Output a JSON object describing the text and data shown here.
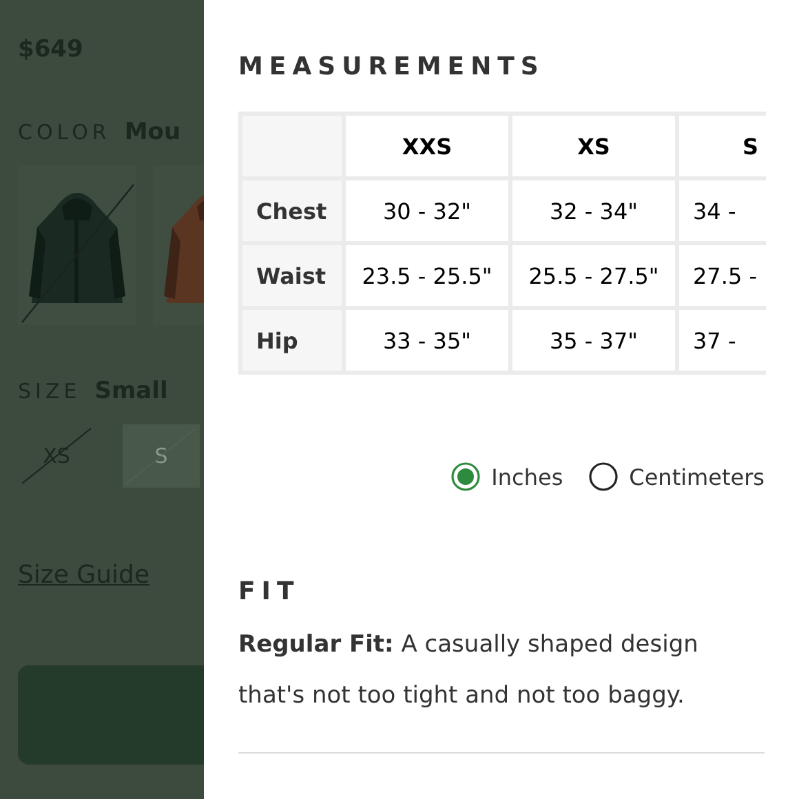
{
  "product": {
    "price": "$649",
    "color_label": "COLOR",
    "color_value": "Mou",
    "swatches": [
      {
        "kind": "picture",
        "available": false
      },
      {
        "kind": "picture",
        "available": true
      }
    ],
    "size_label": "SIZE",
    "size_value": "Small",
    "sizes": [
      {
        "label": "XS",
        "available": false,
        "selected": false
      },
      {
        "label": "S",
        "available": false,
        "selected": true
      }
    ],
    "size_guide_link": "Size Guide"
  },
  "measurements": {
    "title": "MEASUREMENTS",
    "columns": [
      "XXS",
      "XS",
      "S"
    ],
    "rows": [
      {
        "label": "Chest",
        "cells": [
          "30 - 32\"",
          "32 - 34\"",
          "34 -"
        ]
      },
      {
        "label": "Waist",
        "cells": [
          "23.5 - 25.5\"",
          "25.5 - 27.5\"",
          "27.5 -"
        ]
      },
      {
        "label": "Hip",
        "cells": [
          "33 - 35\"",
          "35 - 37\"",
          "37 -"
        ]
      }
    ],
    "units": [
      {
        "label": "Inches",
        "selected": true
      },
      {
        "label": "Centimeters",
        "selected": false
      }
    ]
  },
  "fit": {
    "title": "FIT",
    "text": "**Regular Fit:** A casually shaped design that's not too tight and not too baggy."
  }
}
